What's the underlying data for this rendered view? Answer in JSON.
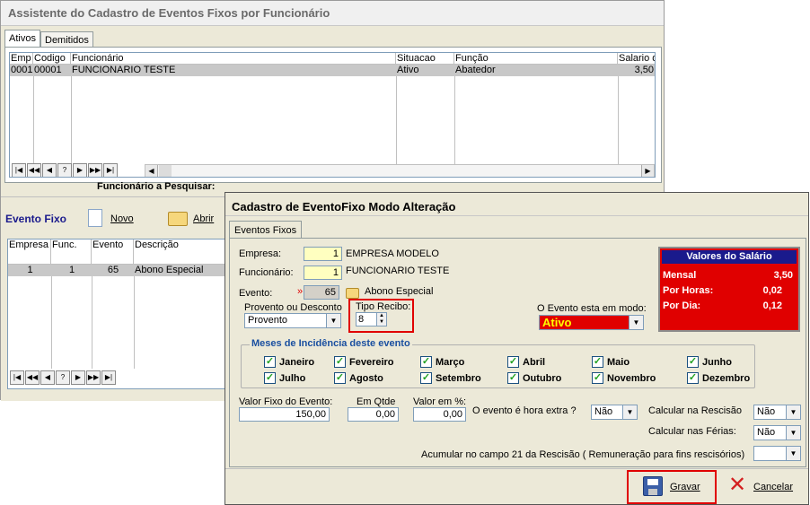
{
  "bg_window": {
    "title": "Assistente do Cadastro de Eventos Fixos por Funcionário",
    "tabs": [
      "Ativos",
      "Demitidos"
    ],
    "grid": {
      "headers": [
        "Emp",
        "Codigo",
        "Funcionário",
        "Situacao",
        "Função",
        "Salario d"
      ],
      "row": [
        "0001",
        "00001",
        "FUNCIONARIO TESTE",
        "Ativo",
        "Abatedor",
        "3,50"
      ]
    },
    "search_label": "Funcionário a Pesquisar:",
    "section_label": "Evento Fixo",
    "novo_label": "Novo",
    "abrir_label": "Abrir",
    "events_grid": {
      "headers": [
        "Empresa",
        "Func.",
        "Evento",
        "Descrição"
      ],
      "row": [
        "1",
        "1",
        "65",
        "Abono Especial"
      ]
    },
    "nav_buttons": [
      "|◀",
      "◀◀",
      "◀",
      "?",
      "▶",
      "▶▶",
      "▶|"
    ]
  },
  "dialog": {
    "title": "Cadastro de EventoFixo Modo Alteração",
    "tab": "Eventos Fixos",
    "empresa_label": "Empresa:",
    "empresa_value": "1",
    "empresa_name": "EMPRESA MODELO",
    "funcionario_label": "Funcionário:",
    "funcionario_value": "1",
    "funcionario_name": "FUNCIONARIO TESTE",
    "evento_label": "Evento:",
    "evento_marker": "»",
    "evento_value": "65",
    "evento_name": "Abono Especial",
    "prov_label": "Provento ou Desconto",
    "prov_value": "Provento",
    "tipo_label": "Tipo Recibo:",
    "tipo_value": "8",
    "modo_label": "O Evento esta em modo:",
    "modo_value": "Ativo",
    "valores": {
      "title": "Valores do Salário",
      "mensal_label": "Mensal",
      "mensal_value": "3,50",
      "horas_label": "Por Horas:",
      "horas_value": "0,02",
      "dia_label": "Por  Dia:",
      "dia_value": "0,12"
    },
    "meses_label": "Meses de Incidência deste evento",
    "months": [
      "Janeiro",
      "Fevereiro",
      "Março",
      "Abril",
      "Maio",
      "Junho",
      "Julho",
      "Agosto",
      "Setembro",
      "Outubro",
      "Novembro",
      "Dezembro"
    ],
    "valor_fixo_label": "Valor Fixo do Evento:",
    "valor_fixo_value": "150,00",
    "qtde_label": "Em Qtde",
    "qtde_value": "0,00",
    "pct_label": "Valor em  %:",
    "pct_value": "0,00",
    "hora_extra_label": "O evento é hora extra ?",
    "hora_extra_value": "Não",
    "rescisao_label": "Calcular na Rescisão",
    "rescisao_value": "Não",
    "ferias_label": "Calcular nas  Férias:",
    "ferias_value": "Não",
    "acumular_label": "Acumular no  campo 21 da Rescisão ( Remuneração  para fins rescisórios)",
    "acumular_value": "",
    "gravar_label": "Gravar",
    "cancelar_label": "Cancelar"
  },
  "colors": {
    "red": "#e00000",
    "navy": "#1a1a8c",
    "highlight": "#ffffc0"
  }
}
